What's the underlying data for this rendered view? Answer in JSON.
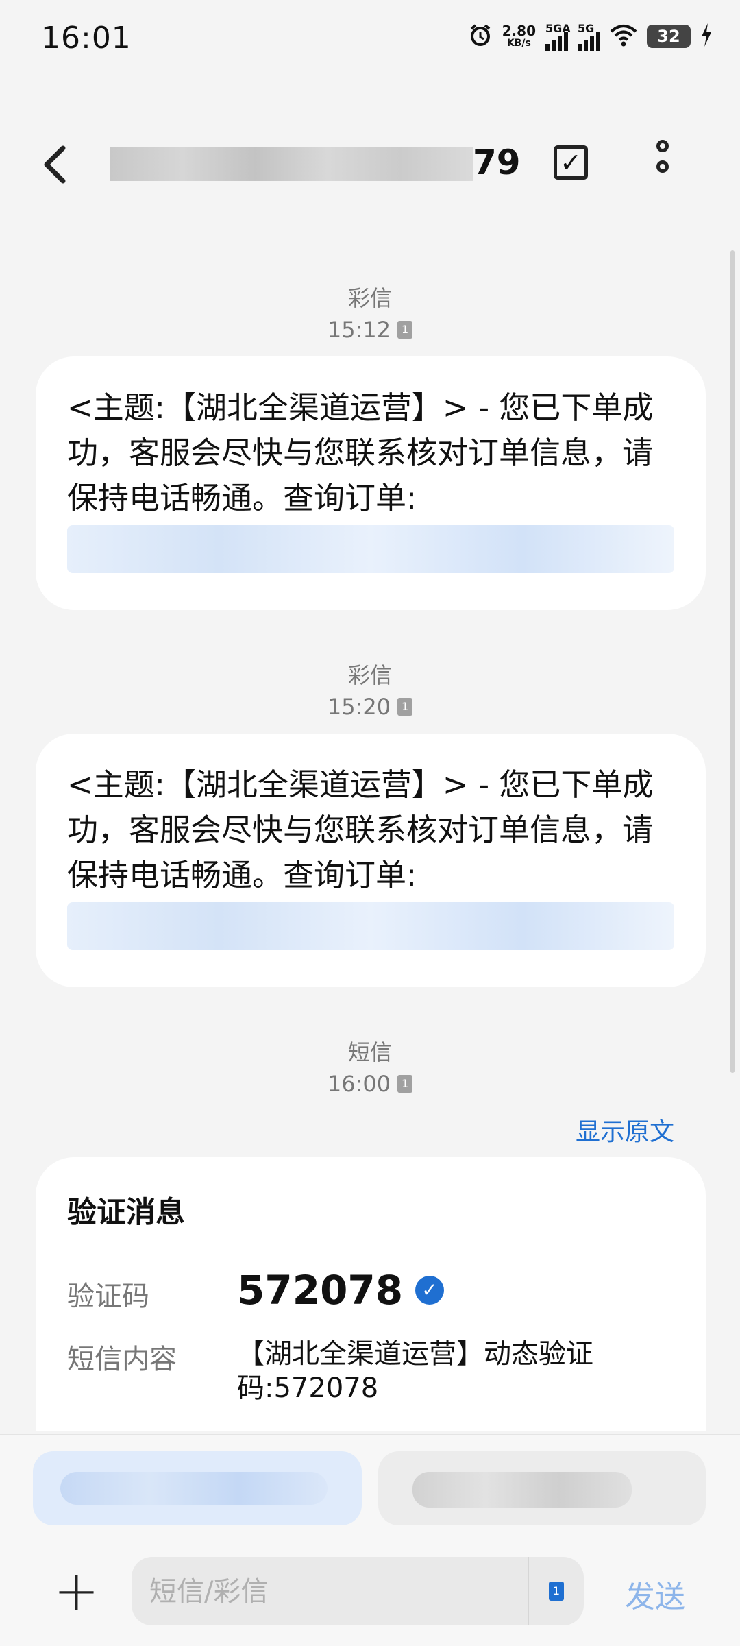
{
  "status_bar": {
    "time": "16:01",
    "net_speed_value": "2.80",
    "net_speed_unit": "KB/s",
    "sim1_label": "5GA",
    "sim2_label": "5G",
    "battery": "32"
  },
  "header": {
    "title_suffix": "79"
  },
  "messages": [
    {
      "type": "彩信",
      "time": "15:12",
      "sim": "1",
      "text": "<主题:【湖北全渠道运营】> - 您已下单成功，客服会尽快与您联系核对订单信息，请保持电话畅通。查询订单:"
    },
    {
      "type": "彩信",
      "time": "15:20",
      "sim": "1",
      "text": "<主题:【湖北全渠道运营】> - 您已下单成功，客服会尽快与您联系核对订单信息，请保持电话畅通。查询订单:"
    },
    {
      "type": "短信",
      "time": "16:00",
      "sim": "1"
    }
  ],
  "show_original": "显示原文",
  "verify_card": {
    "title": "验证消息",
    "code_label": "验证码",
    "code": "572078",
    "content_label": "短信内容",
    "content": "【湖北全渠道运营】动态验证码:572078"
  },
  "composer": {
    "placeholder": "短信/彩信",
    "send_label": "发送",
    "sim": "1"
  },
  "colors": {
    "accent": "#1f6fd1",
    "background": "#f4f4f4"
  }
}
